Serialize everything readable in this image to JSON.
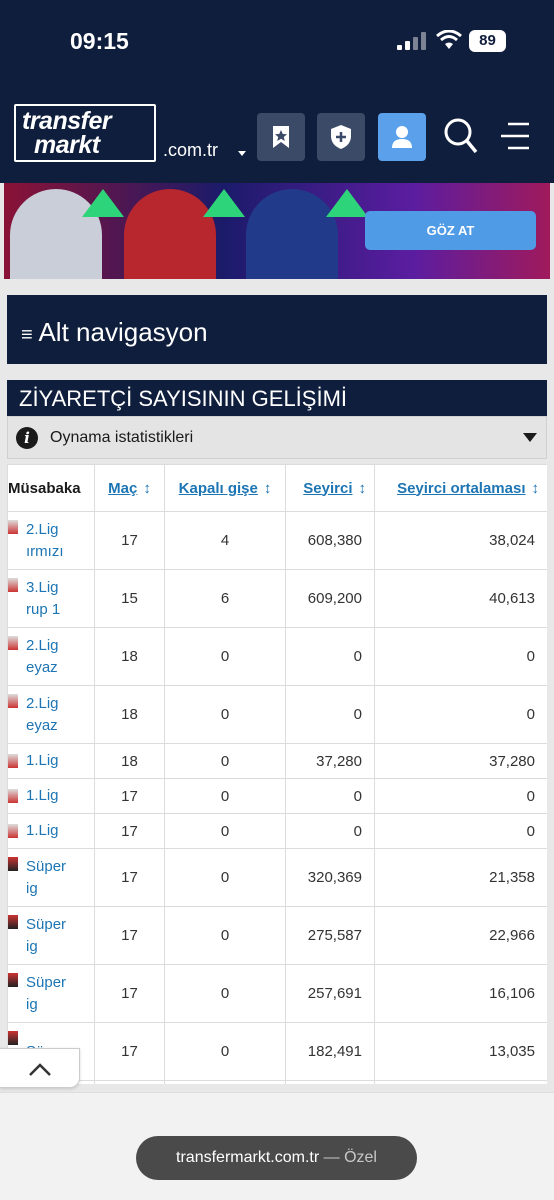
{
  "status": {
    "time": "09:15",
    "battery": "89"
  },
  "header": {
    "logo_line1": "transfer",
    "logo_line2": "markt",
    "domain": ".com.tr"
  },
  "banner": {
    "cta": "GÖZ AT"
  },
  "nav": {
    "alt_nav": "Alt navigasyon"
  },
  "section": {
    "title": "ZİYARETÇİ SAYISININ GELİŞİMİ",
    "stats_label": "Oynama istatistikleri"
  },
  "table": {
    "headers": {
      "competition": "Müsabaka",
      "matches": "Maç",
      "sold_out": "Kapalı gişe",
      "attendance": "Seyirci",
      "avg": "Seyirci ortalaması"
    },
    "rows": [
      {
        "l1": "2.Lig",
        "l2": "ırmızı",
        "matches": "17",
        "sold_out": "4",
        "attendance": "608,380",
        "avg": "38,024"
      },
      {
        "l1": "3.Lig",
        "l2": "rup 1",
        "matches": "15",
        "sold_out": "6",
        "attendance": "609,200",
        "avg": "40,613"
      },
      {
        "l1": "2.Lig",
        "l2": "eyaz",
        "matches": "18",
        "sold_out": "0",
        "attendance": "0",
        "avg": "0"
      },
      {
        "l1": "2.Lig",
        "l2": "eyaz",
        "matches": "18",
        "sold_out": "0",
        "attendance": "0",
        "avg": "0"
      },
      {
        "l1": "1.Lig",
        "l2": "",
        "matches": "18",
        "sold_out": "0",
        "attendance": "37,280",
        "avg": "37,280"
      },
      {
        "l1": "1.Lig",
        "l2": "",
        "matches": "17",
        "sold_out": "0",
        "attendance": "0",
        "avg": "0"
      },
      {
        "l1": "1.Lig",
        "l2": "",
        "matches": "17",
        "sold_out": "0",
        "attendance": "0",
        "avg": "0"
      },
      {
        "l1": "Süper",
        "l2": "ig",
        "matches": "17",
        "sold_out": "0",
        "attendance": "320,369",
        "avg": "21,358"
      },
      {
        "l1": "Süper",
        "l2": "ig",
        "matches": "17",
        "sold_out": "0",
        "attendance": "275,587",
        "avg": "22,966"
      },
      {
        "l1": "Süper",
        "l2": "ig",
        "matches": "17",
        "sold_out": "0",
        "attendance": "257,691",
        "avg": "16,106"
      },
      {
        "l1": "Süper",
        "l2": "",
        "matches": "17",
        "sold_out": "0",
        "attendance": "182,491",
        "avg": "13,035"
      }
    ]
  },
  "browser": {
    "url": "transfermarkt.com.tr",
    "suffix": "— Özel"
  },
  "colors": {
    "navy": "#0f1e3c",
    "link": "#1d75b3",
    "accent": "#5aa0ea"
  }
}
